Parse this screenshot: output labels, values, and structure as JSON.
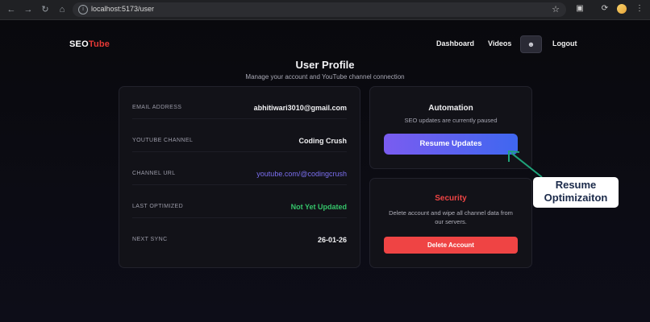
{
  "browser": {
    "url": "localhost:5173/user",
    "icons": [
      "back-icon",
      "forward-icon",
      "reload-icon",
      "home-icon",
      "site-info-icon",
      "star-icon",
      "extensions-icon",
      "sync-icon",
      "profile-avatar",
      "menu-icon"
    ]
  },
  "header": {
    "logo_seo": "SEO",
    "logo_tube": "Tube",
    "nav": {
      "dashboard": "Dashboard",
      "videos": "Videos",
      "logout": "Logout"
    }
  },
  "page": {
    "title": "User Profile",
    "subtitle": "Manage your account and YouTube channel connection"
  },
  "profile": {
    "rows": [
      {
        "label": "EMAIL ADDRESS",
        "value": "abhitiwari3010@gmail.com"
      },
      {
        "label": "YOUTUBE CHANNEL",
        "value": "Coding Crush"
      },
      {
        "label": "CHANNEL URL",
        "value": "youtube.com/@codingcrush"
      },
      {
        "label": "LAST OPTIMIZED",
        "value": "Not Yet Updated"
      },
      {
        "label": "NEXT SYNC",
        "value": "26-01-26"
      }
    ]
  },
  "automation": {
    "title": "Automation",
    "status": "SEO updates are currently paused",
    "button": "Resume Updates"
  },
  "security": {
    "title": "Security",
    "description": "Delete account and wipe all channel data from our servers.",
    "button": "Delete Account"
  },
  "annotation": {
    "line1": "Resume",
    "line2": "Optimizaiton"
  },
  "colors": {
    "accent_red": "#ef4444",
    "link_purple": "#7b6ff0",
    "status_green": "#35c46a",
    "annotation_arrow": "#1fa37a"
  }
}
